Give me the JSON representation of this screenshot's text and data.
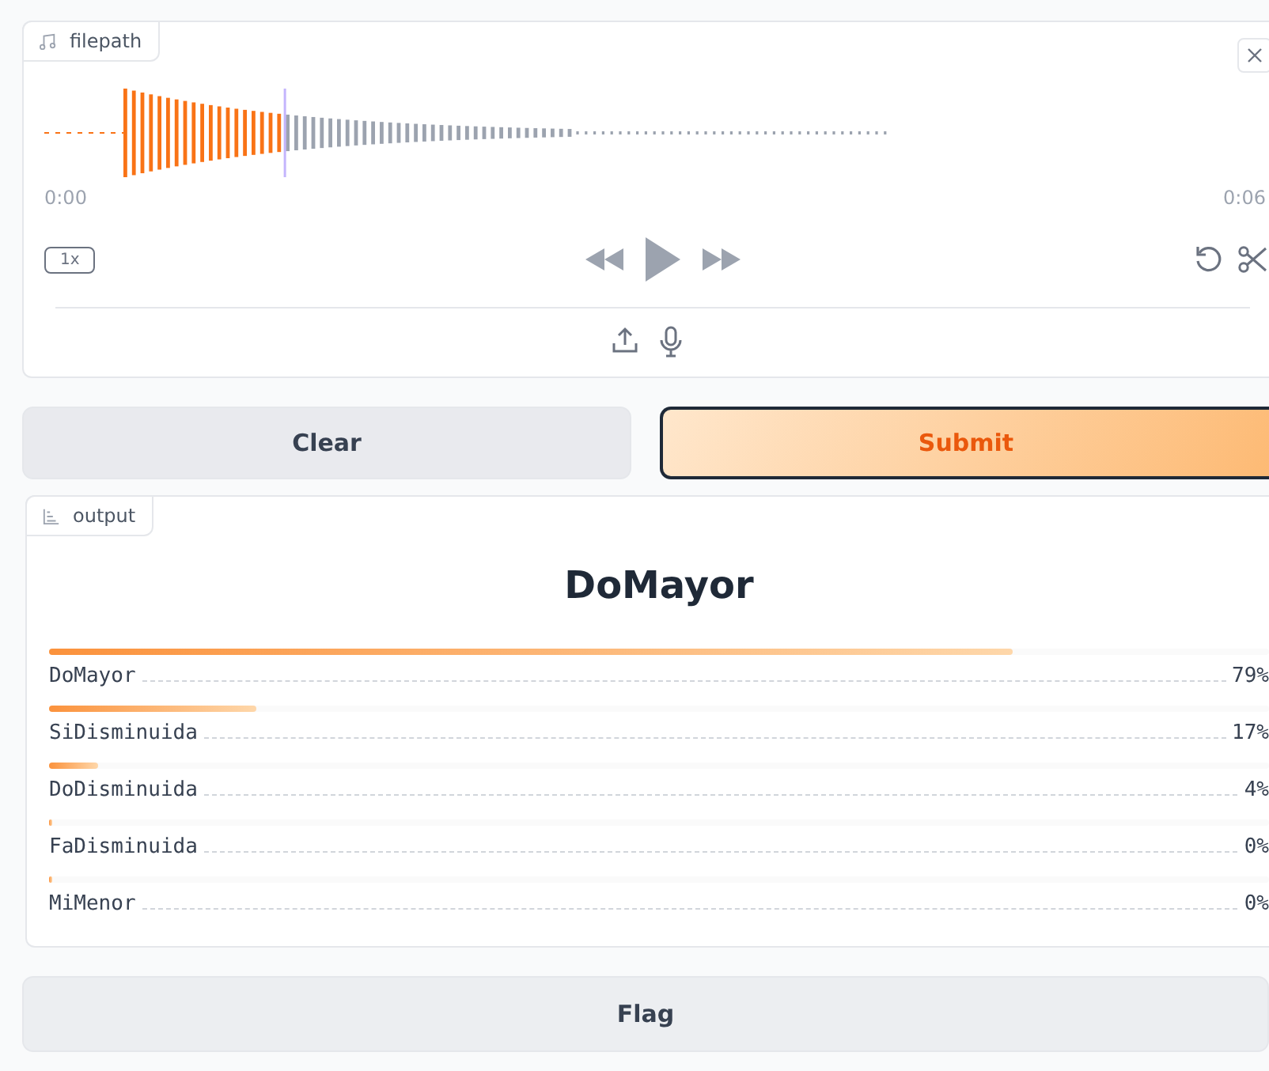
{
  "audio": {
    "label": "filepath",
    "time_start": "0:00",
    "time_end": "0:06",
    "speed": "1x"
  },
  "buttons": [
    {
      "label": "Clear",
      "kind": "secondary"
    },
    {
      "label": "Submit",
      "kind": "primary"
    }
  ],
  "output": {
    "label": "output",
    "title": "DoMayor",
    "confidences": [
      {
        "name": "DoMayor",
        "reading": "79%",
        "level": 0.79
      },
      {
        "name": "SiDisminuida",
        "reading": "17%",
        "level": 0.17
      },
      {
        "name": "DoDisminuida",
        "reading": "4%",
        "level": 0.04
      },
      {
        "name": "FaDisminuida",
        "reading": "0%",
        "level": 0
      },
      {
        "name": "MiMenor",
        "reading": "0%",
        "level": 0
      }
    ]
  },
  "flag_button": {
    "label": "Flag"
  }
}
